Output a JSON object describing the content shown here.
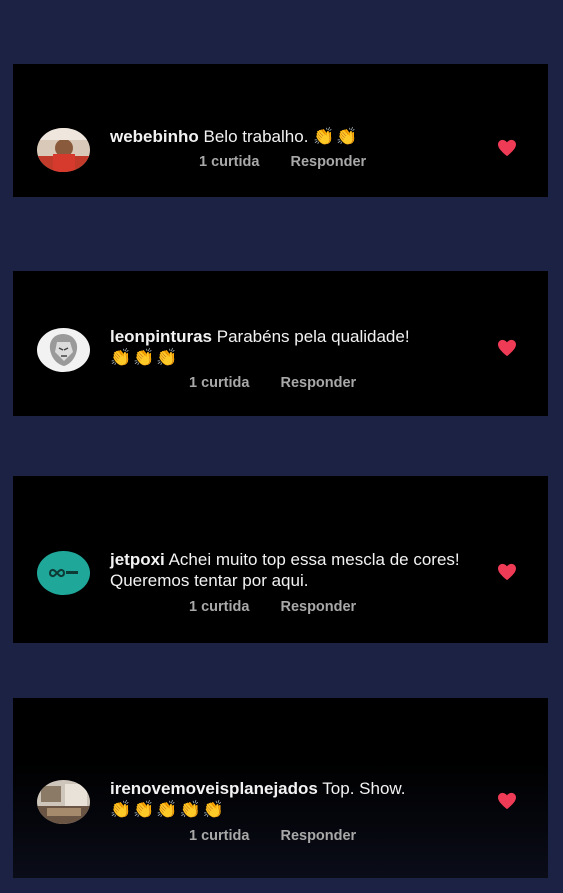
{
  "colors": {
    "background": "#1b2244",
    "card": "#000000",
    "heart": "#ef3b55",
    "meta": "#a8a8a8"
  },
  "comments": [
    {
      "username": "webebinho",
      "text": "Belo trabalho.",
      "emoji": "👏👏",
      "likes": "1 curtida",
      "reply": "Responder",
      "avatar": "user-photo"
    },
    {
      "username": "leonpinturas",
      "text": "Parabéns pela qualidade!",
      "emoji": "👏👏👏",
      "likes": "1 curtida",
      "reply": "Responder",
      "avatar": "lion-logo"
    },
    {
      "username": "jetpoxi",
      "text": "Achei muito top essa mescla de cores! Queremos tentar por aqui.",
      "emoji": "",
      "likes": "1 curtida",
      "reply": "Responder",
      "avatar": "teal-logo"
    },
    {
      "username": "irenovemoveisplanejados",
      "text": "Top. Show.",
      "emoji": "👏👏👏👏👏",
      "likes": "1 curtida",
      "reply": "Responder",
      "avatar": "room-photo"
    }
  ]
}
